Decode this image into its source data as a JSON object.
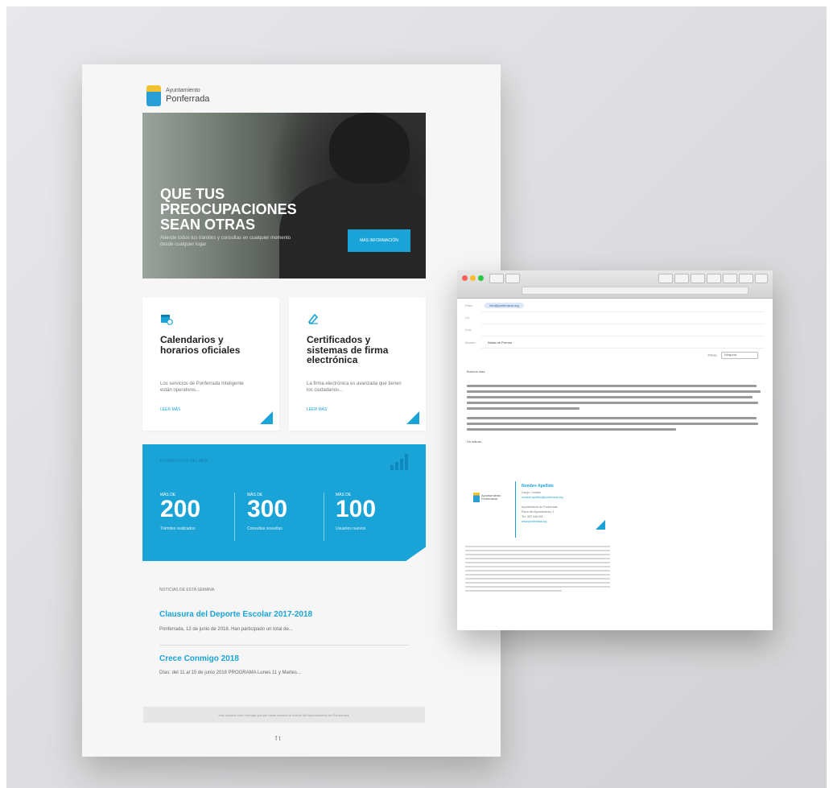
{
  "newsletter": {
    "logo_small": "Ayuntamiento",
    "logo_big": "Ponferrada",
    "hero_title": "QUE TUS PREOCUPACIONES SEAN OTRAS",
    "hero_subtitle": "Atiende todos tus trámites y consultas en cualquier momento desde cualquier lugar",
    "hero_button": "MÁS INFORMACIÓN",
    "cards": [
      {
        "title": "Calendarios y horarios oficiales",
        "desc": "Los servicios de Ponferrada Inteligente están operativos...",
        "link": "LEER MÁS",
        "icon": "calendar-clock-icon"
      },
      {
        "title": "Certificados y sistemas de firma electrónica",
        "desc": "La firma electrónica es avanzada que tienen los ciudadanos...",
        "link": "LEER MÁS",
        "icon": "pen-signature-icon"
      }
    ],
    "stats_header": "ESTADÍSTICAS DEL MES",
    "stats": [
      {
        "prefix": "MÁS DE",
        "value": "200",
        "label": "Trámites realizados"
      },
      {
        "prefix": "MÁS DE",
        "value": "300",
        "label": "Consultas resueltas"
      },
      {
        "prefix": "MÁS DE",
        "value": "100",
        "label": "Usuarios nuevos"
      }
    ],
    "news_header": "NOTICIAS DE ESTA SEMANA",
    "news": [
      {
        "title": "Clausura del Deporte Escolar 2017-2018",
        "summary": "Ponferrada, 12 de junio de 2018. Han participado un total de..."
      },
      {
        "title": "Crece Conmigo 2018",
        "summary": "Días: del 11 al 15 de junio 2018 PROGRAMA Lunes 11 y Martes..."
      }
    ],
    "footer_text": "Has recibido este mensaje porque estás suscrito al boletín del Ayuntamiento de Ponferrada.",
    "social": "f  t"
  },
  "mail": {
    "to_label": "Para:",
    "to_value": "info@ponferrada.org",
    "cc_label": "Cc:",
    "cco_label": "Cco:",
    "subject_label": "Asunto:",
    "subject_value": "Notas de Prensa",
    "firma_label": "Firma:",
    "firma_value": "Ninguna",
    "greeting": "Buenos días,",
    "closing": "Un saludo,",
    "sig_logo": "Ayuntamiento Ponferrada",
    "sig_name": "Nombre Apellido",
    "sig_lines": [
      "Cargo / Unidad",
      "nombre.apellido@ponferrada.org",
      "Ayuntamiento de Ponferrada",
      "Plaza del Ayuntamiento, 1",
      "Tel.: 987 446 600",
      "www.ponferrada.org"
    ]
  },
  "colors": {
    "accent": "#1aa3d6",
    "background": "#dcdcde",
    "sheet": "#f6f6f6"
  }
}
